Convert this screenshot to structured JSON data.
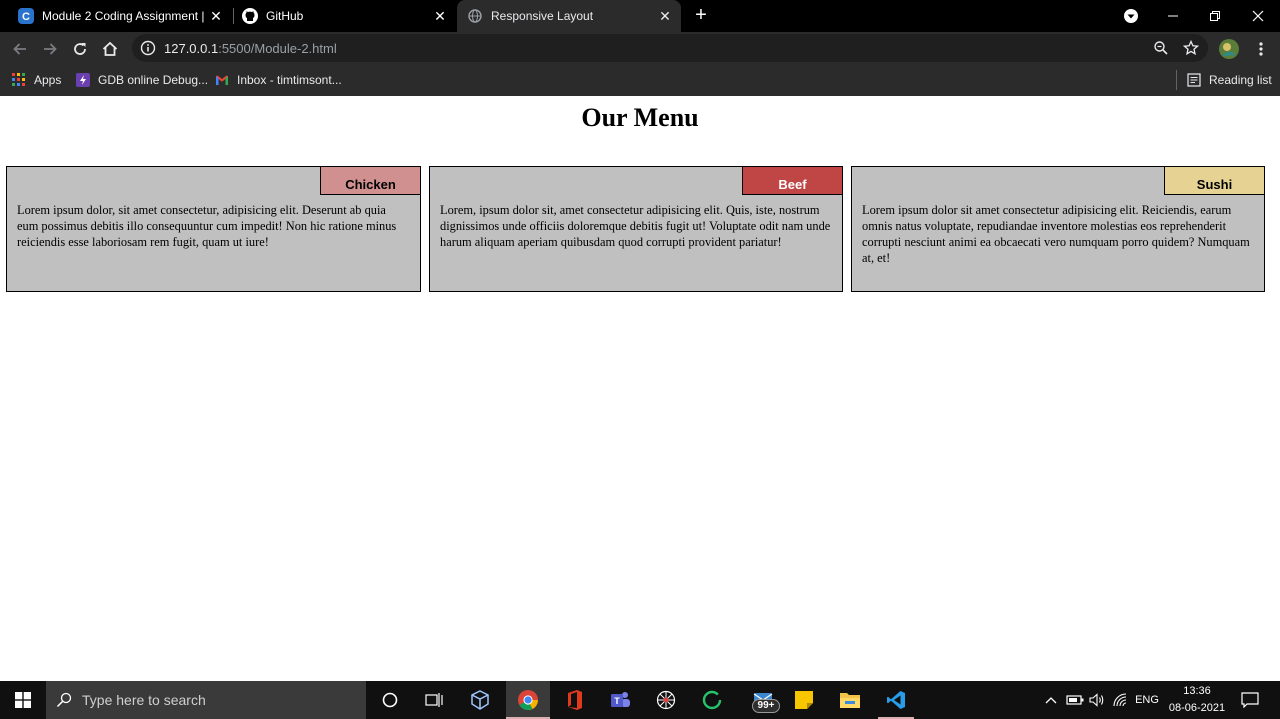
{
  "browser": {
    "tabs": [
      {
        "title": "Module 2 Coding Assignment | C",
        "favicon": "coursera-icon",
        "active": false
      },
      {
        "title": "GitHub",
        "favicon": "github-icon",
        "active": false
      },
      {
        "title": "Responsive Layout",
        "favicon": "globe-icon",
        "active": true
      }
    ],
    "url_host": "127.0.0.1",
    "url_path": ":5500/Module-2.html",
    "bookmarks": [
      {
        "label": "Apps",
        "icon": "apps-grid-icon"
      },
      {
        "label": "GDB online Debug...",
        "icon": "gdb-icon"
      },
      {
        "label": "Inbox - timtimsont...",
        "icon": "gmail-icon"
      }
    ],
    "reading_list": "Reading list"
  },
  "page": {
    "heading": "Our Menu",
    "cards": [
      {
        "tag": "Chicken",
        "tag_color": "#d09090",
        "text": "Lorem ipsum dolor, sit amet consectetur, adipisicing elit. Deserunt ab quia eum possimus debitis illo consequuntur cum impedit! Non hic ratione minus reiciendis esse laboriosam rem fugit, quam ut iure!"
      },
      {
        "tag": "Beef",
        "tag_color": "#c04545",
        "text": "Lorem, ipsum dolor sit, amet consectetur adipisicing elit. Quis, iste, nostrum dignissimos unde officiis doloremque debitis fugit ut! Voluptate odit nam unde harum aliquam aperiam quibusdam quod corrupti provident pariatur!"
      },
      {
        "tag": "Sushi",
        "tag_color": "#e6d292",
        "text": "Lorem ipsum dolor sit amet consectetur adipisicing elit. Reiciendis, earum omnis natus voluptate, repudiandae inventore molestias eos reprehenderit corrupti nesciunt animi ea obcaecati vero numquam porro quidem? Numquam at, et!"
      }
    ],
    "card_bg": "#c0c0c0"
  },
  "taskbar": {
    "search_placeholder": "Type here to search",
    "badge": "99+",
    "language": "ENG",
    "time": "13:36",
    "date": "08-06-2021"
  }
}
